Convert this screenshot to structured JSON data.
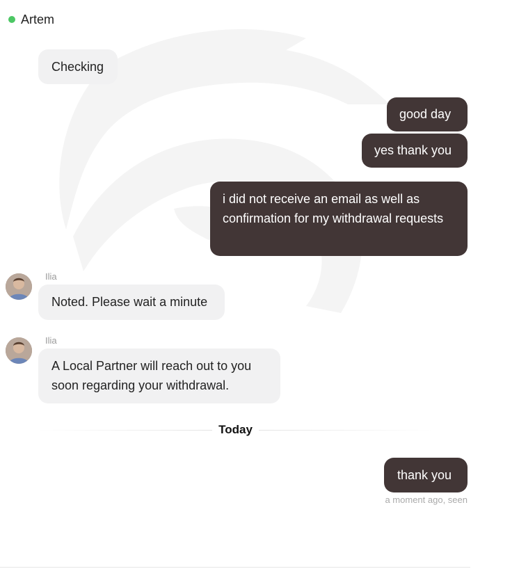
{
  "header": {
    "contact_name": "Artem",
    "status_color": "#4cc764"
  },
  "messages": [
    {
      "direction": "in",
      "text": "Checking"
    },
    {
      "direction": "out",
      "text": "good day"
    },
    {
      "direction": "out",
      "text": "yes thank you"
    },
    {
      "direction": "out",
      "text": "i did not receive an email as well as confirmation for my withdrawal requests"
    },
    {
      "direction": "in",
      "sender": "Ilia",
      "text": "Noted. Please wait a minute"
    },
    {
      "direction": "in",
      "sender": "Ilia",
      "text": "A Local Partner will reach out to you soon regarding your withdrawal."
    },
    {
      "direction": "out",
      "text": "thank you"
    }
  ],
  "divider": {
    "label": "Today"
  },
  "last_status": "a moment ago, seen",
  "colors": {
    "outgoing_bubble": "#423636",
    "incoming_bubble": "#f1f1f2",
    "online": "#4cc764"
  }
}
